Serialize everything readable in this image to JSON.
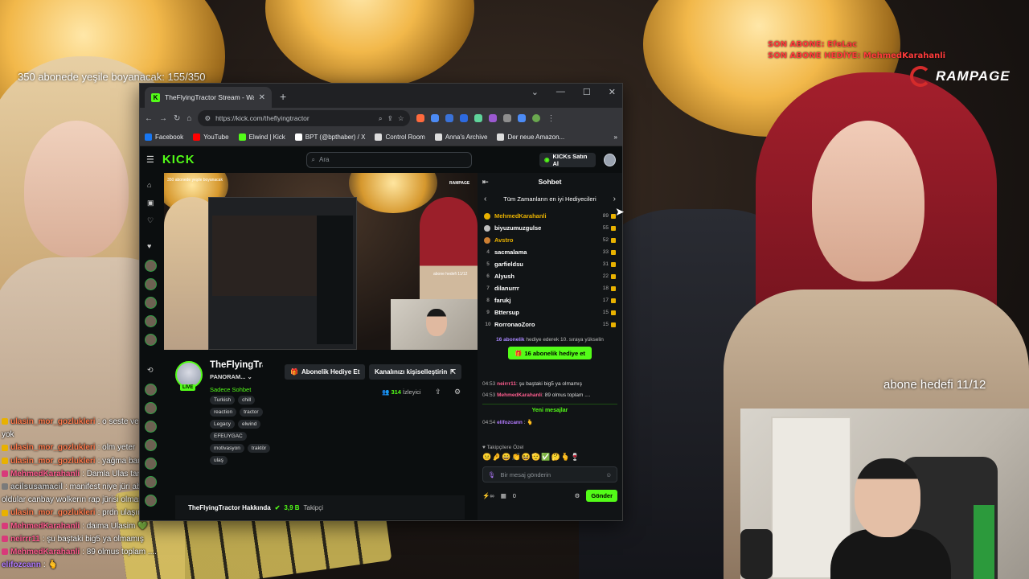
{
  "overlay": {
    "sub_goal_text": "350 abonede yeşile boyanacak: 155/350",
    "last_sub": "SON ABONE: EfeLac",
    "last_sub_gift": "SON ABONE HEDİYE: MehmedKarahanli",
    "brand": "RAMPAGE",
    "goal_label": "abone hedefi 11/12"
  },
  "overlay_chat": [
    {
      "user": "ulasin_mor_gozlukleri",
      "text": ": o seste ve sürtüne ile girme iht",
      "color": "#ff7b4d",
      "badge": "#e8b100"
    },
    {
      "user": "",
      "text": "yok",
      "color": "#ffffff",
      "badge": ""
    },
    {
      "user": "ulasin_mor_gozlukleri",
      "text": ": olm yeter",
      "color": "#ff7b4d",
      "badge": "#e8b100"
    },
    {
      "user": "ulasin_mor_gozlukleri",
      "text": ": yağma banaağağağağağağağa",
      "color": "#ff7b4d",
      "badge": "#e8b100"
    },
    {
      "user": "MehmedKarahanli",
      "text": ": Damla Ulas tarafından torpilli",
      "color": "#ff5d8f",
      "badge": "#d83a7a"
    },
    {
      "user": "acilsusamacil",
      "text": ": manifest niye jüri abi 1 sene önce şarkıcı",
      "color": "#c9c9c9",
      "badge": "#7a7a7a"
    },
    {
      "user": "",
      "text": "oldular canbay wolkerın rap jürisi olması gibi",
      "color": "#ffffff",
      "badge": ""
    },
    {
      "user": "ulasin_mor_gozlukleri",
      "text": ": prdn ulaşım",
      "color": "#ff7b4d",
      "badge": "#e8b100"
    },
    {
      "user": "MehmedKarahanli",
      "text": ": daima Ulasim 💚",
      "color": "#ff5d8f",
      "badge": "#d83a7a"
    },
    {
      "user": "neirrr11",
      "text": ": şu baştaki big5 ya olmamış",
      "color": "#ff5d8f",
      "badge": "#d83a7a"
    },
    {
      "user": "MehmedKarahanli",
      "text": ": 89 olmus toplam ....",
      "color": "#ff5d8f",
      "badge": "#d83a7a"
    },
    {
      "user": "elifozcann",
      "text": ": 🫰",
      "color": "#b37bff",
      "badge": ""
    }
  ],
  "browser": {
    "tab_title": "TheFlyingTractor Stream - Watch",
    "tab_favicon": "K",
    "url": "https://kick.com/theflyingtractor",
    "bookmarks": [
      {
        "label": "Facebook",
        "color": "#1877f2"
      },
      {
        "label": "YouTube",
        "color": "#ff0000"
      },
      {
        "label": "Elwind | Kick",
        "color": "#53fc18"
      },
      {
        "label": "BPT (@bpthaber) / X",
        "color": "#ffffff"
      },
      {
        "label": "Control Room",
        "color": "#dddddd"
      },
      {
        "label": "Anna's Archive",
        "color": "#dddddd"
      },
      {
        "label": "Der neue Amazon...",
        "color": "#dddddd"
      }
    ]
  },
  "kick": {
    "logo": "KICK",
    "search_placeholder": "Ara",
    "buy_kicks": "KICKs Satın Al",
    "channel_name": "TheFlyingTractor",
    "category": "PANORAM...",
    "live": "LIVE",
    "chat_mode": "Sadece Sohbet",
    "tags": [
      "Turkish",
      "chill",
      "reaction",
      "tractor",
      "Legacy",
      "elwind",
      "EFEUYGAC",
      "motivasyon",
      "traktör",
      "ulaş"
    ],
    "sub_gift_btn": "Abonelik Hediye Et",
    "customize_btn": "Kanalınızı kişiselleştirin",
    "viewer_count": "314",
    "viewer_label": "İzleyici",
    "about_label": "TheFlyingTractor Hakkında",
    "followers": "3,9 B",
    "followers_label": "Takipçi",
    "video_text": {
      "top_label": "350 abonede yeşile boyanacak",
      "brand": "RAMPAGE",
      "goal": "abone hedefi 11/12"
    }
  },
  "chat": {
    "title": "Sohbet",
    "leaderboard_title": "Tüm Zamanların en iyi Hediyecileri",
    "leaders": [
      {
        "rank": "1",
        "name": "MehmedKarahanli",
        "count": "89",
        "color": "#e8b100",
        "medal": "#e8b100"
      },
      {
        "rank": "2",
        "name": "biyuzumuzgulse",
        "count": "55",
        "color": "#ffffff",
        "medal": "#c0c0c0"
      },
      {
        "rank": "3",
        "name": "Avstro",
        "count": "52",
        "color": "#e8b100",
        "medal": "#cd7f32"
      },
      {
        "rank": "4",
        "name": "sacmalama",
        "count": "33",
        "color": "#ffffff",
        "medal": ""
      },
      {
        "rank": "5",
        "name": "garfieldsu",
        "count": "31",
        "color": "#ffffff",
        "medal": ""
      },
      {
        "rank": "6",
        "name": "Alyush",
        "count": "22",
        "color": "#ffffff",
        "medal": ""
      },
      {
        "rank": "7",
        "name": "dilanurrr",
        "count": "18",
        "color": "#ffffff",
        "medal": ""
      },
      {
        "rank": "8",
        "name": "farukj",
        "count": "17",
        "color": "#ffffff",
        "medal": ""
      },
      {
        "rank": "9",
        "name": "Bttersup",
        "count": "15",
        "color": "#ffffff",
        "medal": ""
      },
      {
        "rank": "10",
        "name": "RorronaoZoro",
        "count": "15",
        "color": "#ffffff",
        "medal": ""
      }
    ],
    "rank_note_count": "16 abonelik",
    "rank_note_rest": "hediye ederek 10. sıraya yükselin",
    "gift_btn": "16 abonelik hediye et",
    "messages": [
      {
        "time": "04:53",
        "user": "neirrr11",
        "text": ": şu baştaki big5 ya olmamış",
        "color": "#ff5d8f"
      },
      {
        "time": "04:53",
        "user": "MehmedKarahanli",
        "text": ": 89 olmus toplam ....",
        "color": "#ff5d8f"
      }
    ],
    "new_messages": "Yeni mesajlar",
    "last_msg": {
      "time": "04:54",
      "user": "elifozcann",
      "text": ": 🫰",
      "color": "#b37bff"
    },
    "emote_section": "Takipçilere Özel",
    "emotes": "😐🤌😄👏😆🫡✅🤔🫰🍷",
    "input_placeholder": "Bir mesaj gönderin",
    "points": "0",
    "send": "Gönder"
  }
}
